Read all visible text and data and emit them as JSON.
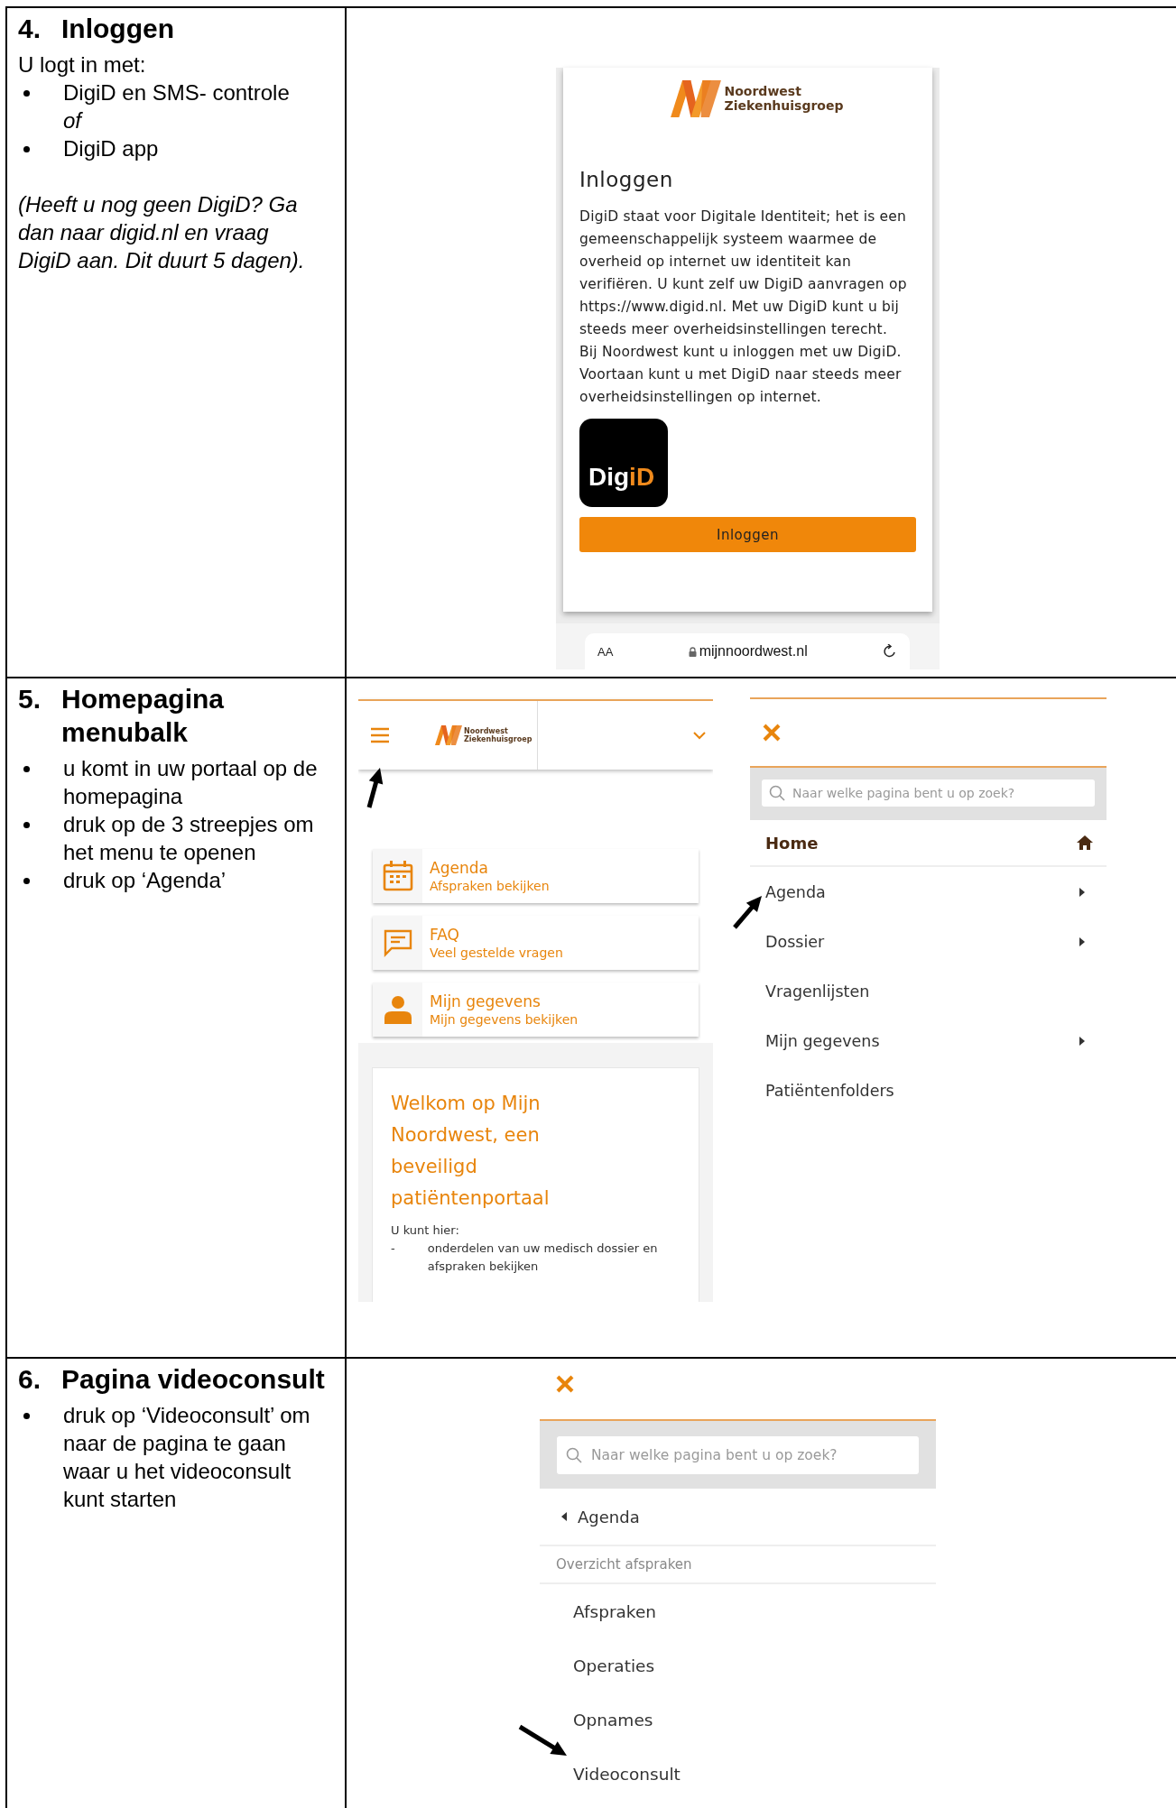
{
  "sections": [
    {
      "kind": "login",
      "heading": {
        "number": "4.",
        "title": "Inloggen"
      },
      "lines": [
        {
          "kind": "plain",
          "text": "U logt in met:"
        },
        {
          "kind": "bullet",
          "text": "DigiD en SMS- controle"
        },
        {
          "kind": "indent_italic",
          "text": "of"
        },
        {
          "kind": "bullet",
          "text": "DigiD app"
        },
        {
          "kind": "note",
          "text": "(Heeft u nog geen DigiD? Ga dan naar digid.nl en vraag DigiD aan. Dit duurt 5 dagen)."
        }
      ],
      "screens": [
        {
          "kind": "login",
          "logo": {
            "line_1": "Noordwest",
            "line_2": "Ziekenhuisgroep"
          },
          "title": "Inloggen",
          "paragraphs": [
            "DigiD staat voor Digitale Identiteit; het is een gemeenschappelijk systeem waarmee de overheid op internet uw identiteit kan verifiëren. U kunt zelf uw DigiD aanvragen op https://www.digid.nl. Met uw DigiD kunt u bij steeds meer overheidsinstellingen terecht.",
            "Bij Noordwest kunt u inloggen met uw DigiD. Voortaan kunt u met DigiD naar steeds meer overheidsinstellingen op internet."
          ],
          "digid_logo": {
            "main": "Dig",
            "accent": "iD"
          },
          "button": "Inloggen",
          "browser_bar": {
            "text_size": "AA",
            "url": "mijnnoordwest.nl"
          }
        }
      ]
    },
    {
      "kind": "home",
      "heading": {
        "number": "5.",
        "title": "Homepagina menubalk"
      },
      "lines": [
        {
          "kind": "bullet",
          "text": "u komt in uw portaal op de homepagina"
        },
        {
          "kind": "bullet",
          "text": "druk op de 3 streepjes om het menu te openen"
        },
        {
          "kind": "bullet",
          "text": "druk op ‘Agenda’"
        }
      ],
      "screens": [
        {
          "kind": "home",
          "header": {
            "logo": {
              "line_1": "Noordwest",
              "line_2": "Ziekenhuisgroep"
            },
            "menu_pointed": true
          },
          "tiles": [
            {
              "kind": "calendar",
              "title": "Agenda",
              "subtitle": "Afspraken bekijken"
            },
            {
              "kind": "chat",
              "title": "FAQ",
              "subtitle": "Veel gestelde vragen"
            },
            {
              "kind": "person",
              "title": "Mijn gegevens",
              "subtitle": "Mijn gegevens bekijken"
            }
          ],
          "welcome": {
            "title": "Welkom op Mijn Noordwest, een beveiligd patiëntenportaal",
            "intro": "U kunt hier:",
            "items": [
              {
                "marker": "-",
                "text": "onderdelen van uw medisch dossier en afspraken bekijken"
              }
            ]
          }
        },
        {
          "kind": "menu",
          "search_placeholder": "Naar welke pagina bent u op zoek?",
          "items": [
            {
              "kind": "home",
              "label": "Home",
              "pointed": false
            },
            {
              "kind": "submenu",
              "label": "Agenda",
              "pointed": true
            },
            {
              "kind": "submenu",
              "label": "Dossier",
              "pointed": false
            },
            {
              "kind": "plain",
              "label": "Vragenlijsten",
              "pointed": false
            },
            {
              "kind": "submenu",
              "label": "Mijn gegevens",
              "pointed": false
            },
            {
              "kind": "plain",
              "label": "Patiëntenfolders",
              "pointed": false
            }
          ]
        }
      ]
    },
    {
      "kind": "submenu",
      "heading": {
        "number": "6.",
        "title": "Pagina videoconsult"
      },
      "lines": [
        {
          "kind": "bullet",
          "text": "druk op ‘Videoconsult’ om naar de pagina te gaan waar u het videoconsult kunt starten"
        }
      ],
      "screens": [
        {
          "kind": "submenu",
          "search_placeholder": "Naar welke pagina bent u op zoek?",
          "back": "Agenda",
          "group": "Overzicht afspraken",
          "items": [
            {
              "label": "Afspraken",
              "pointed": false
            },
            {
              "label": "Operaties",
              "pointed": false
            },
            {
              "label": "Opnames",
              "pointed": false
            },
            {
              "label": "Videoconsult",
              "pointed": true
            }
          ]
        }
      ]
    }
  ]
}
